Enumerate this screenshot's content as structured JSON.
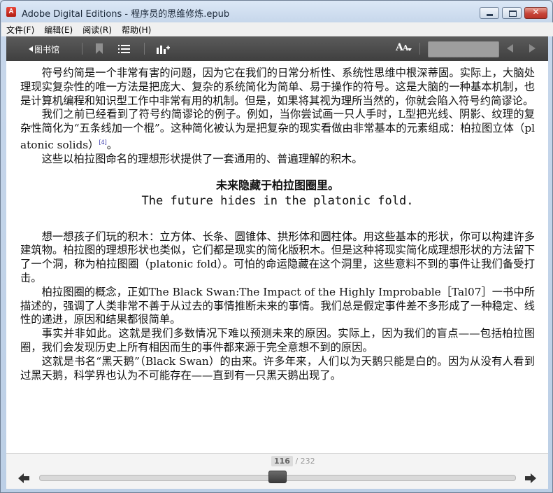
{
  "window": {
    "title": "Adobe Digital Editions - 程序员的思维修炼.epub"
  },
  "menu": [
    {
      "label": "文件(F)"
    },
    {
      "label": "编辑(E)"
    },
    {
      "label": "阅读(R)"
    },
    {
      "label": "帮助(H)"
    }
  ],
  "toolbar": {
    "library_label": "图书馆",
    "font_size_glyph": "A",
    "font_size_glyph_small": "A",
    "icons": [
      "back-arrow-icon",
      "bookmark-icon",
      "toc-list-icon",
      "stats-icon",
      "font-size-icon",
      "prev-arrow-icon",
      "next-arrow-icon"
    ]
  },
  "content": {
    "p1": "符号约简是一个非常有害的问题，因为它在我们的日常分析性、系统性思维中根深蒂固。实际上，大脑处理现实复杂性的唯一方法是把庞大、复杂的系统简化为简单、易于操作的符号。这是大脑的一种基本机制，也是计算机编程和知识型工作中非常有用的机制。但是，如果将其视为理所当然的，你就会陷入符号约简谬论。",
    "p2_a": "我们之前已经看到了符号约简谬论的例子。例如，当你尝试画一只人手时，L型把光线、阴影、纹理的复杂性简化为“五条线加一个棍”。这种简化被认为是把复杂的现实看做由非常基本的元素组成：柏拉图立体（platonic solids）",
    "p2_fn": "[4]",
    "p2_b": "。",
    "p3": "这些以柏拉图命名的理想形状提供了一套通用的、普遍理解的积木。",
    "heading_cn": "未来隐藏于柏拉图圈里。",
    "heading_en": "The future hides in the platonic fold.",
    "p4": "想一想孩子们玩的积木：立方体、长条、圆锥体、拱形体和圆柱体。用这些基本的形状，你可以构建许多建筑物。柏拉图的理想形状也类似，它们都是现实的简化版积木。但是这种将现实简化成理想形状的方法留下了一个洞，称为柏拉图圈（platonic fold）。可怕的命运隐藏在这个洞里，这些意料不到的事件让我们备受打击。",
    "p5": "柏拉图圈的概念，正如The Black Swan:The Impact of the Highly Improbable［Tal07］一书中所描述的，强调了人类非常不善于从过去的事情推断未来的事情。我们总是假定事件差不多形成了一种稳定、线性的递进，原因和结果都很简单。",
    "p6": "事实并非如此。这就是我们多数情况下难以预测未来的原因。实际上，因为我们的盲点——包括柏拉图圈，我们会发现历史上所有相因而生的事件都来源于完全意想不到的原因。",
    "p7": "这就是书名“黑天鹅”（Black Swan）的由来。许多年来，人们以为天鹅只能是白的。因为从没有人看到过黑天鹅，科学界也认为不可能存在——直到有一只黑天鹅出现了。"
  },
  "pagination": {
    "current": "116",
    "separator": " / ",
    "total": "232",
    "progress_fraction": 0.5
  }
}
